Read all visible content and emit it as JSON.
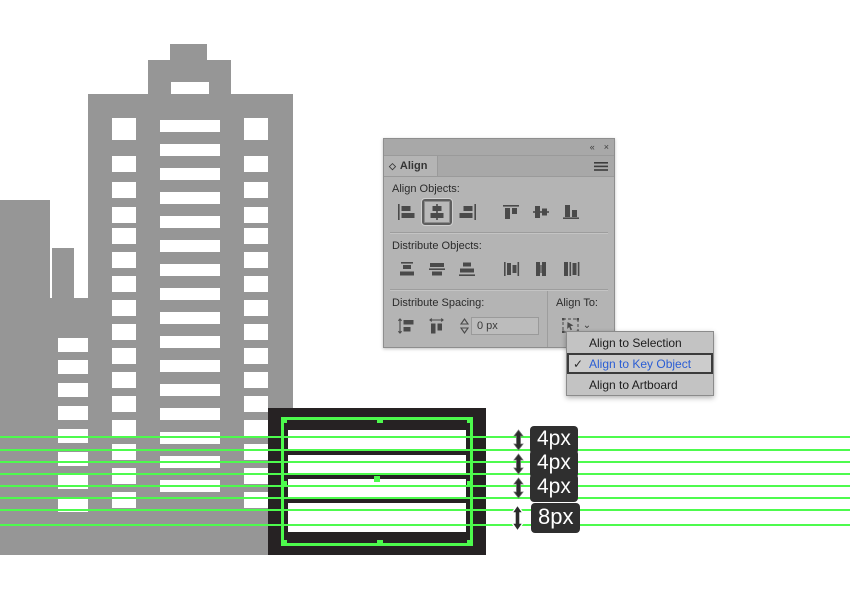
{
  "app": {
    "name": "vector-illustration-editor"
  },
  "panel": {
    "tab_label": "Align",
    "tab_icon": "diamond-icon",
    "collapse_label": "«",
    "close_label": "×",
    "menu_icon": "hamburger-menu-icon",
    "align_objects": {
      "label": "Align Objects:",
      "buttons": [
        {
          "name": "horizontal-align-left",
          "selected": false
        },
        {
          "name": "horizontal-align-center",
          "selected": true
        },
        {
          "name": "horizontal-align-right",
          "selected": false
        },
        {
          "name": "vertical-align-top",
          "selected": false
        },
        {
          "name": "vertical-align-center",
          "selected": false
        },
        {
          "name": "vertical-align-bottom",
          "selected": false
        }
      ]
    },
    "distribute_objects": {
      "label": "Distribute Objects:",
      "buttons": [
        {
          "name": "vertical-distribute-top",
          "selected": false
        },
        {
          "name": "vertical-distribute-center",
          "selected": false
        },
        {
          "name": "vertical-distribute-bottom",
          "selected": false
        },
        {
          "name": "horizontal-distribute-left",
          "selected": false
        },
        {
          "name": "horizontal-distribute-center",
          "selected": false
        },
        {
          "name": "horizontal-distribute-right",
          "selected": false
        }
      ]
    },
    "distribute_spacing": {
      "label": "Distribute Spacing:",
      "buttons": [
        {
          "name": "vertical-distribute-spacing",
          "selected": false
        },
        {
          "name": "horizontal-distribute-spacing",
          "selected": false
        }
      ],
      "input_value": "0 px",
      "input_placeholder": "0 px"
    },
    "align_to": {
      "label": "Align To:",
      "button_icon": "align-to-key-object-icon",
      "chevron": "⌄"
    }
  },
  "align_to_menu": {
    "items": [
      {
        "label": "Align to Selection",
        "checked": false,
        "highlighted": false
      },
      {
        "label": "Align to Key Object",
        "checked": true,
        "highlighted": true
      },
      {
        "label": "Align to Artboard",
        "checked": false,
        "highlighted": false
      }
    ],
    "check_glyph": "✓"
  },
  "canvas": {
    "measurements": [
      {
        "value": "4px",
        "strong": false
      },
      {
        "value": "4px",
        "strong": false
      },
      {
        "value": "4px",
        "strong": false
      },
      {
        "value": "8px",
        "strong": true
      }
    ],
    "guide_color": "#4dfb4d",
    "selection_color": "#4dfb4d",
    "artwork_gray": "#969696",
    "artwork_dark": "#262223"
  }
}
